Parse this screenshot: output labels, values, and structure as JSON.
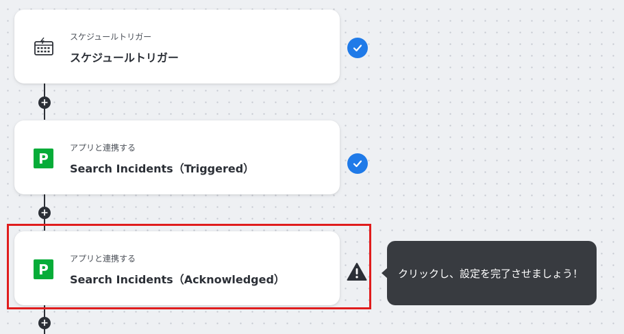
{
  "flow": {
    "steps": [
      {
        "category": "スケジュールトリガー",
        "title": "スケジュールトリガー",
        "icon": "calendar-schedule-icon",
        "status": "complete"
      },
      {
        "category": "アプリと連携する",
        "title": "Search Incidents（Triggered）",
        "icon": "pagerduty-icon",
        "icon_text": "P",
        "status": "complete"
      },
      {
        "category": "アプリと連携する",
        "title": "Search Incidents（Acknowledged）",
        "icon": "pagerduty-icon",
        "icon_text": "P",
        "status": "warning"
      }
    ],
    "add_step_icon": "+"
  },
  "tooltip": {
    "text": "クリックし、設定を完了させましょう！"
  },
  "colors": {
    "check": "#1f7ae8",
    "highlight": "#e01c1c",
    "tooltip_bg": "#383b40",
    "pagerduty_green": "#06ac38",
    "connector": "#2b2f36"
  }
}
